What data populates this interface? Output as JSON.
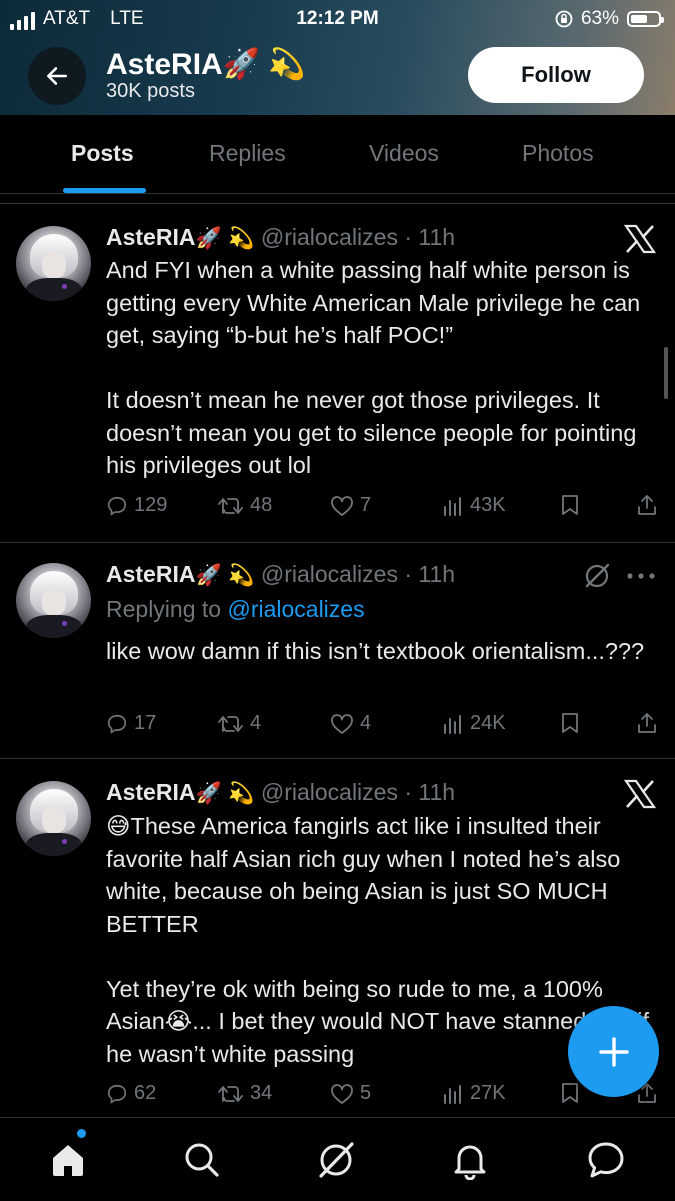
{
  "status_bar": {
    "carrier": "AT&T",
    "network": "LTE",
    "time": "12:12 PM",
    "battery_percent_label": "63%",
    "battery_level": 0.63
  },
  "header": {
    "name": "AsteRIA🚀 💫",
    "posts_count": "30K posts",
    "follow_label": "Follow"
  },
  "tabs": [
    {
      "label": "Posts",
      "active": true
    },
    {
      "label": "Replies",
      "active": false
    },
    {
      "label": "Videos",
      "active": false
    },
    {
      "label": "Photos",
      "active": false
    }
  ],
  "posts": [
    {
      "name": "AsteRIA",
      "emojis": "🚀 💫",
      "handle_time": "@rialocalizes · 11h",
      "top_icon": "x-logo-icon",
      "text": "And FYI when a white passing half white person is getting every White American Male privilege he can get, saying “b-but he’s half POC!”\n\nIt doesn’t mean he never got those privileges. It doesn’t mean you get to silence people for pointing his privileges out lol",
      "replies": "129",
      "reposts": "48",
      "likes": "7",
      "views": "43K"
    },
    {
      "name": "AsteRIA",
      "emojis": "🚀 💫",
      "handle_time": "@rialocalizes · 11h",
      "top_icon": "grok-icon",
      "more_icon": "more-dots-icon",
      "replying_to_prefix": "Replying to ",
      "replying_to_handle": "@rialocalizes",
      "text": "like wow damn if this isn’t textbook orientalism...???",
      "replies": "17",
      "reposts": "4",
      "likes": "4",
      "views": "24K"
    },
    {
      "name": "AsteRIA",
      "emojis": "🚀 💫",
      "handle_time": "@rialocalizes · 11h",
      "top_icon": "x-logo-icon",
      "text": "😅These America fangirls act like i insulted their favorite half Asian rich guy when I noted he’s also white, because oh being Asian is just SO MUCH BETTER\n\nYet they’re ok with being so rude to me, a 100% Asian😭... I bet they would NOT have stanned him if he wasn’t white passing",
      "replies": "62",
      "reposts": "34",
      "likes": "5",
      "views": "27K"
    }
  ],
  "bottom_nav": [
    "home-icon",
    "search-icon",
    "grok-icon",
    "notifications-icon",
    "messages-icon"
  ],
  "colors": {
    "accent": "#1d9bf0",
    "background": "#000000",
    "text": "#e7e9ea",
    "muted": "#71767b",
    "divider": "#2f3336"
  }
}
